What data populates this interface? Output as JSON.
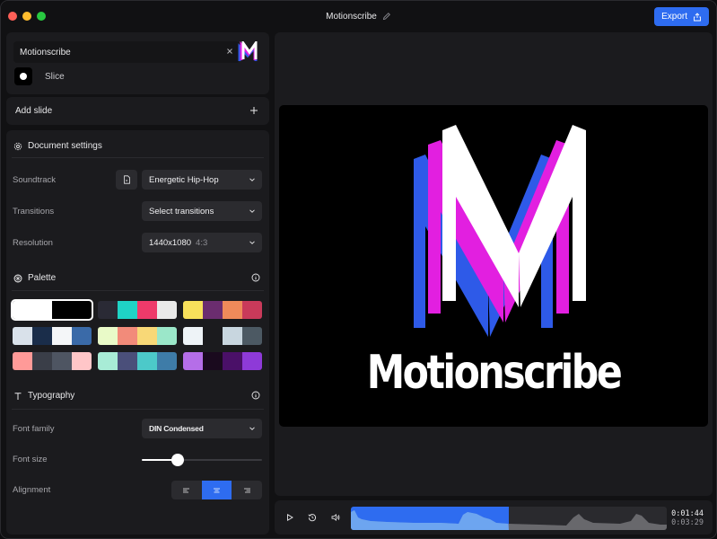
{
  "window": {
    "title": "Motionscribe",
    "export_label": "Export"
  },
  "project": {
    "name": "Motionscribe",
    "slice_label": "Slice",
    "add_slide_label": "Add slide"
  },
  "settings": {
    "heading": "Document settings",
    "soundtrack_label": "Soundtrack",
    "soundtrack_value": "Energetic Hip-Hop",
    "transitions_label": "Transitions",
    "transitions_value": "Select transitions",
    "resolution_label": "Resolution",
    "resolution_value": "1440x1080",
    "resolution_ratio": "4:3"
  },
  "palette": {
    "heading": "Palette",
    "swatches": [
      [
        "#ffffff",
        "#000000"
      ],
      [
        "#2a2a35",
        "#1fd3c6",
        "#ee3a6a",
        "#e9e9e9"
      ],
      [
        "#f7e05b",
        "#6b2d6f",
        "#ef8a5a",
        "#c93a5a"
      ],
      [
        "#d9e1ea",
        "#1a2d4a",
        "#f4f6f8",
        "#3a6aa8"
      ],
      [
        "#e9fac8",
        "#f28b7a",
        "#f8d877",
        "#9be7c9"
      ],
      [
        "#eef3f7",
        "#1b1b1e",
        "#c8d6df",
        "#4c5963"
      ],
      [
        "#ff9a98",
        "#3a3e48",
        "#4e5562",
        "#ffc6c8"
      ],
      [
        "#a8ecd6",
        "#4a4f7a",
        "#4cc9c9",
        "#3e7ca8"
      ],
      [
        "#b56ee8",
        "#1a0a1e",
        "#4a1068",
        "#8e3ad8"
      ]
    ],
    "selected_index": 0
  },
  "typography": {
    "heading": "Typography",
    "font_family_label": "Font family",
    "font_family_value": "DIN Condensed",
    "font_size_label": "Font size",
    "font_size_fraction": 0.3,
    "alignment_label": "Alignment",
    "alignment_value": "center"
  },
  "preview": {
    "title": "Motionscribe"
  },
  "timeline": {
    "current_time": "0:01:44",
    "total_time": "0:03:29",
    "progress_fraction": 0.5
  }
}
